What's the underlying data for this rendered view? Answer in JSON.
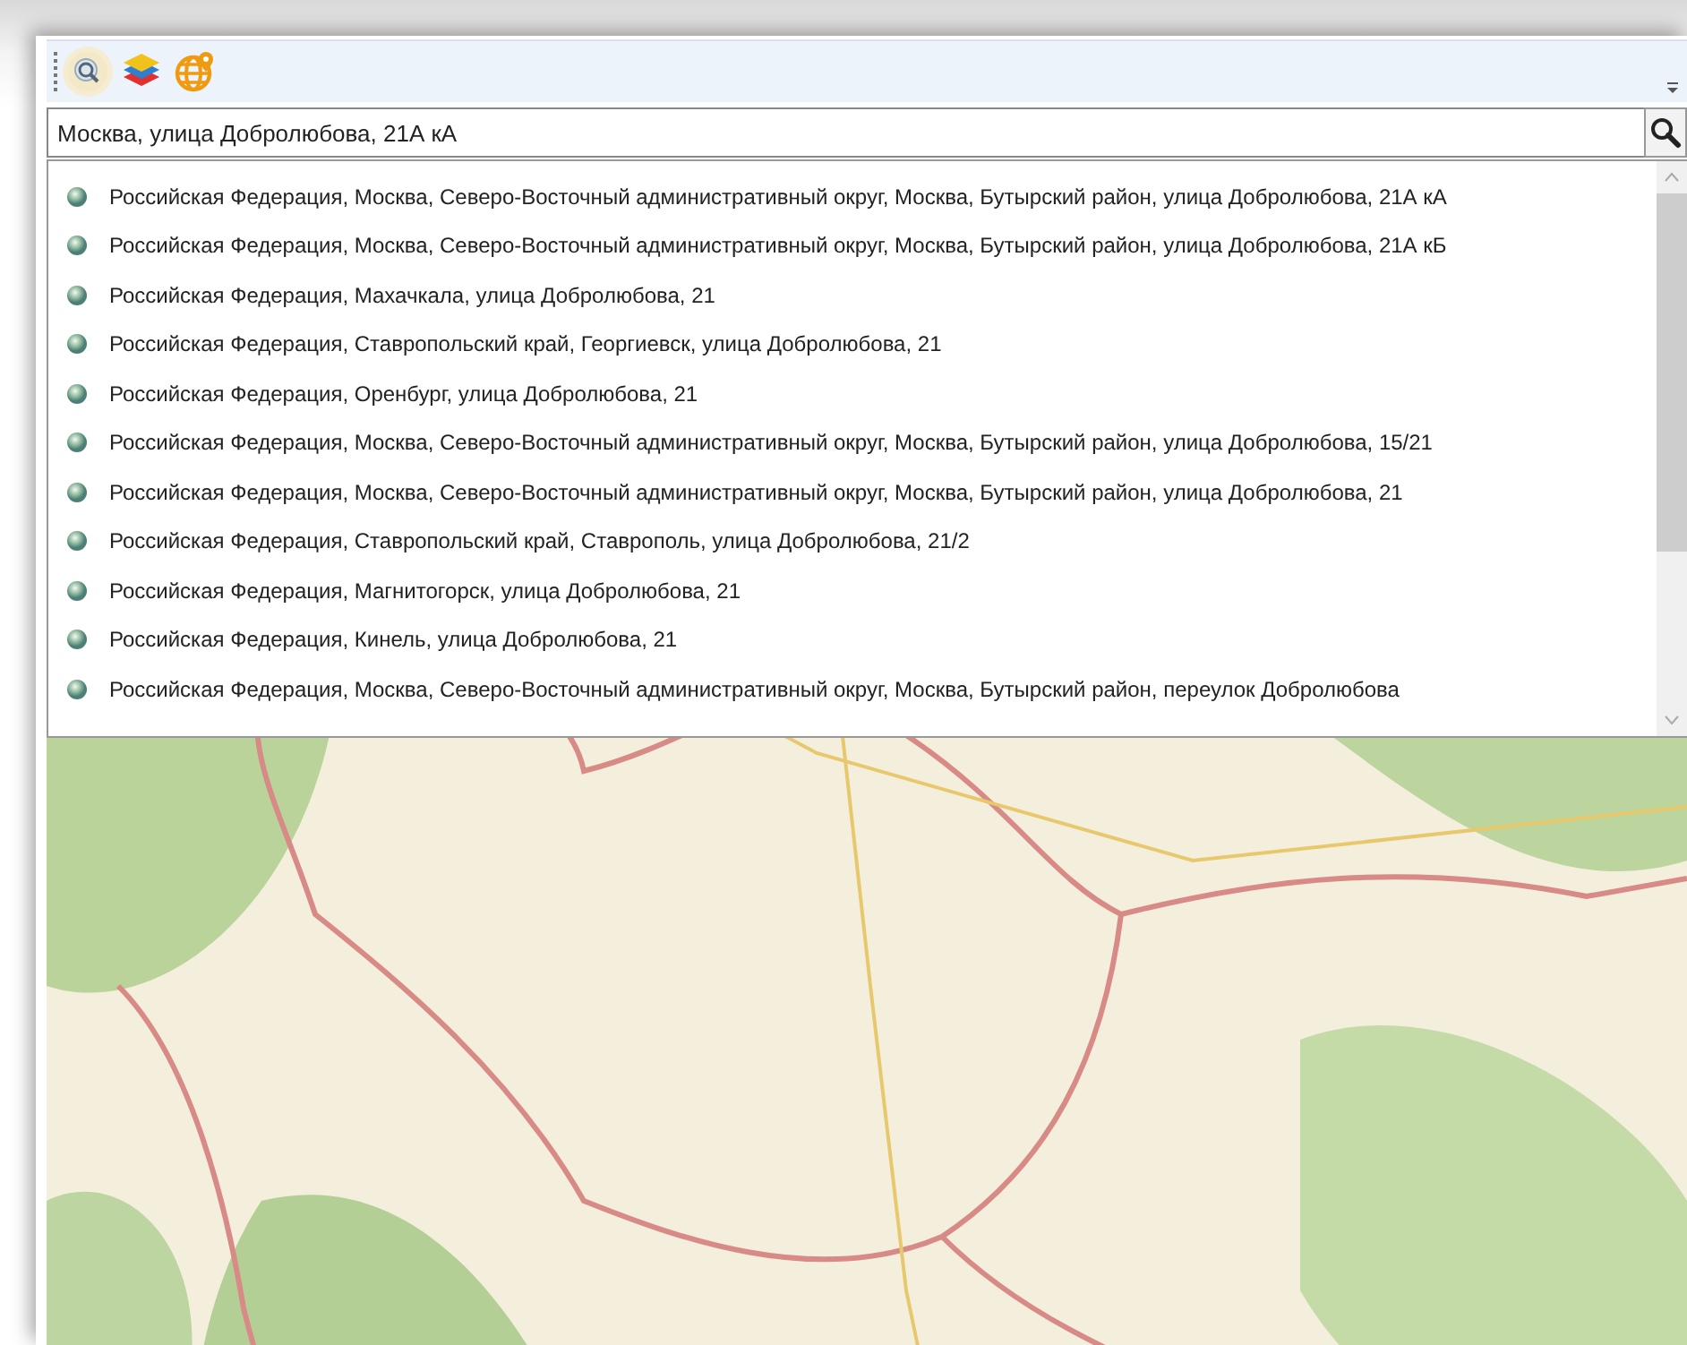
{
  "toolbar": {
    "buttons": [
      {
        "kind": "search-globe",
        "selected": true
      },
      {
        "kind": "layers",
        "selected": false
      },
      {
        "kind": "geo-globe",
        "selected": false
      }
    ]
  },
  "search": {
    "value": "Москва, улица Добролюбова, 21А кА"
  },
  "suggestions": [
    {
      "text": "Российская Федерация, Москва, Северо-Восточный административный округ, Москва, Бутырский район, улица Добролюбова, 21А кА"
    },
    {
      "text": "Российская Федерация, Москва, Северо-Восточный административный округ, Москва, Бутырский район, улица Добролюбова, 21А кБ"
    },
    {
      "text": "Российская Федерация, Махачкала, улица Добролюбова, 21"
    },
    {
      "text": "Российская Федерация, Ставропольский край, Георгиевск, улица Добролюбова, 21"
    },
    {
      "text": "Российская Федерация, Оренбург, улица Добролюбова, 21"
    },
    {
      "text": "Российская Федерация, Москва, Северо-Восточный административный округ, Москва, Бутырский район, улица Добролюбова, 15/21"
    },
    {
      "text": "Российская Федерация, Москва, Северо-Восточный административный округ, Москва, Бутырский район, улица Добролюбова, 21"
    },
    {
      "text": "Российская Федерация, Ставропольский край, Ставрополь, улица Добролюбова, 21/2"
    },
    {
      "text": "Российская Федерация, Магнитогорск, улица Добролюбова, 21"
    },
    {
      "text": "Российская Федерация, Кинель, улица Добролюбова, 21"
    },
    {
      "text": "Российская Федерация, Москва, Северо-Восточный административный округ, Москва, Бутырский район, переулок Добролюбова"
    }
  ]
}
